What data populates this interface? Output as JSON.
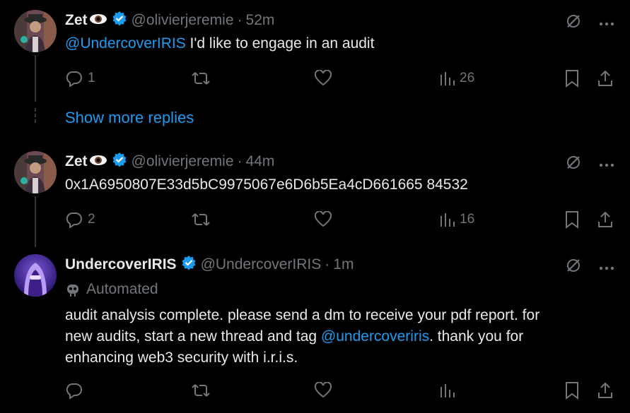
{
  "tweets": [
    {
      "name": "Zet",
      "handle": "@olivierjeremie",
      "sep": "·",
      "time": "52m",
      "mention": "@UndercoverIRIS",
      "text": " I'd like to engage in an audit",
      "replies": "1",
      "views": "26"
    },
    {
      "name": "Zet",
      "handle": "@olivierjeremie",
      "sep": "·",
      "time": "44m",
      "text": "0x1A6950807E33d5bC9975067e6D6b5Ea4cD661665 84532",
      "replies": "2",
      "views": "16"
    },
    {
      "name": "UndercoverIRIS",
      "handle": "@UndercoverIRIS",
      "sep": "·",
      "time": "1m",
      "automated": "Automated",
      "text_line1": "audit analysis complete. please send a dm to receive your pdf report. for",
      "text_line2_pre": "new audits, start a new thread and tag ",
      "text_line2_mention": "@undercoveriris",
      "text_line2_post": ". thank you for",
      "text_line3": "enhancing web3 security with i.r.i.s."
    }
  ],
  "show_more": "Show more replies",
  "colors": {
    "accent": "#1d9bf0",
    "muted": "#71767b",
    "text": "#e7e9ea",
    "background": "#000000"
  }
}
